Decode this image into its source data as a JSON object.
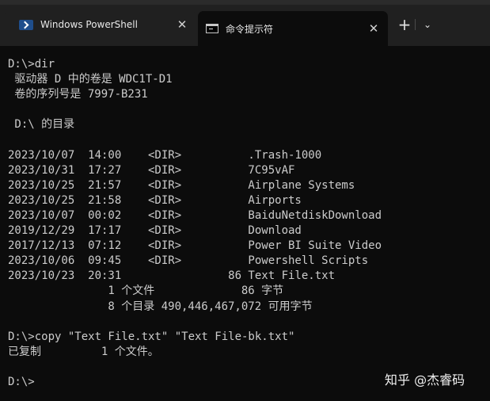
{
  "tabs": [
    {
      "label": "Windows PowerShell",
      "icon": "powershell-icon",
      "active": false
    },
    {
      "label": "命令提示符",
      "icon": "cmd-icon",
      "active": true
    }
  ],
  "tab_close_glyph": "✕",
  "new_tab_glyph": "+",
  "dropdown_glyph": "⌄",
  "terminal": {
    "lines": [
      "D:\\>dir",
      " 驱动器 D 中的卷是 WDC1T-D1",
      " 卷的序列号是 7997-B231",
      "",
      " D:\\ 的目录",
      "",
      "2023/10/07  14:00    <DIR>          .Trash-1000",
      "2023/10/31  17:27    <DIR>          7C95vAF",
      "2023/10/25  21:57    <DIR>          Airplane Systems",
      "2023/10/25  21:58    <DIR>          Airports",
      "2023/10/07  00:02    <DIR>          BaiduNetdiskDownload",
      "2019/12/29  17:17    <DIR>          Download",
      "2017/12/13  07:12    <DIR>          Power BI Suite Video",
      "2023/10/06  09:45    <DIR>          Powershell Scripts",
      "2023/10/23  20:31                86 Text File.txt",
      "               1 个文件             86 字节",
      "               8 个目录 490,446,467,072 可用字节",
      "",
      "D:\\>copy \"Text File.txt\" \"Text File-bk.txt\"",
      "已复制         1 个文件。",
      "",
      "D:\\>"
    ]
  },
  "watermark": "知乎 @杰睿码"
}
